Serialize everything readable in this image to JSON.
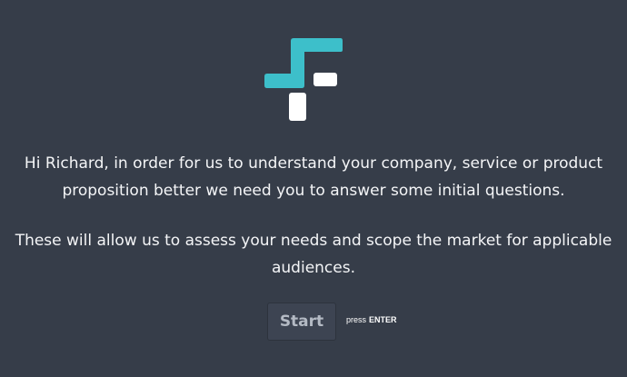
{
  "brand": {
    "logo_icon": "brand-logo-icon",
    "colors": {
      "teal": "#3dbfca",
      "white": "#ffffff",
      "background": "#363d49"
    }
  },
  "intro": {
    "paragraph1_line1": "Hi Richard, in order for us to understand your company, service or product",
    "paragraph1_line2": "proposition better we need you to answer some initial questions.",
    "paragraph2_line1": "These will allow us to assess your needs and scope the market for applicable",
    "paragraph2_line2": "audiences."
  },
  "actions": {
    "start_label": "Start",
    "hint_prefix": "press",
    "hint_key": "ENTER"
  }
}
